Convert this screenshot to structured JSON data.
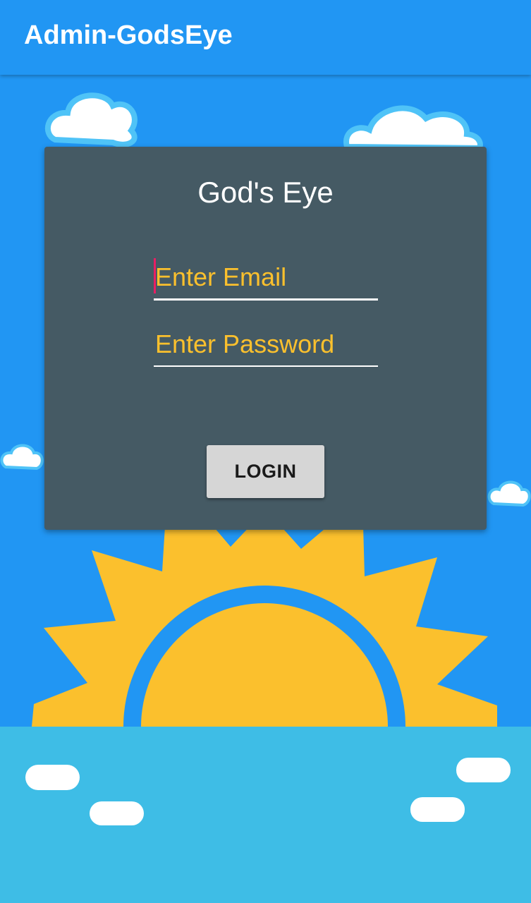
{
  "app_bar": {
    "title": "Admin-GodsEye"
  },
  "login_card": {
    "title": "God's Eye",
    "email_field": {
      "placeholder": "Enter Email",
      "value": ""
    },
    "password_field": {
      "placeholder": "Enter Password",
      "value": ""
    },
    "login_button_label": "LOGIN"
  },
  "colors": {
    "app_bar": "#2196F3",
    "sky": "#2196F3",
    "card": "#455A64",
    "placeholder_text": "#FBC02D",
    "caret": "#E91E63",
    "sun": "#FBC02D",
    "sea": "#3EBDE6",
    "clouds": "#FFFFFF",
    "cloud_outline": "#4FC3F7",
    "button": "#D6D6D6"
  },
  "icons": [
    "cloud-icon",
    "sun-icon"
  ]
}
